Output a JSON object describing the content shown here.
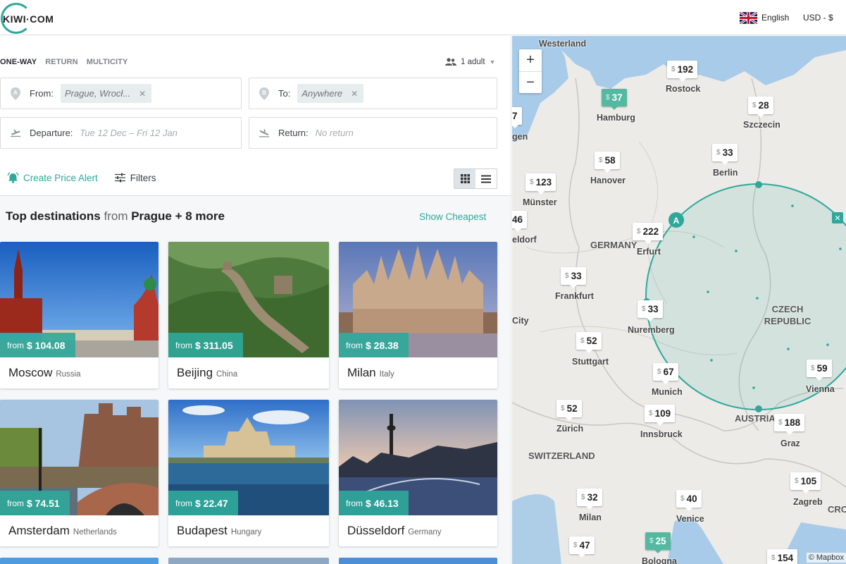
{
  "brand": {
    "name": "KIWI·COM",
    "accent": "#2fa89b"
  },
  "header": {
    "language": "English",
    "currency": "USD - $"
  },
  "search": {
    "trip_types": [
      "ONE-WAY",
      "RETURN",
      "MULTICITY"
    ],
    "active_trip_type": "ONE-WAY",
    "passengers": "1 adult",
    "from_label": "From:",
    "from_value": "Prague, Wrocł...",
    "to_label": "To:",
    "to_value": "Anywhere",
    "departure_label": "Departure:",
    "departure_value": "Tue 12 Dec – Fri 12 Jan",
    "return_label": "Return:",
    "return_value": "No return",
    "create_alert": "Create Price Alert",
    "filters": "Filters"
  },
  "results": {
    "heading_prefix": "Top destinations",
    "heading_from": "from",
    "heading_origin": "Prague + 8 more",
    "show_cheapest": "Show Cheapest",
    "price_prefix": "from",
    "cards": [
      {
        "city": "Moscow",
        "country": "Russia",
        "price": "$ 104.08"
      },
      {
        "city": "Beijing",
        "country": "China",
        "price": "$ 311.05"
      },
      {
        "city": "Milan",
        "country": "Italy",
        "price": "$ 28.38"
      },
      {
        "city": "Amsterdam",
        "country": "Netherlands",
        "price": "$ 74.51"
      },
      {
        "city": "Budapest",
        "country": "Hungary",
        "price": "$ 22.47"
      },
      {
        "city": "Düsseldorf",
        "country": "Germany",
        "price": "$ 46.13"
      }
    ]
  },
  "map": {
    "zoom_in": "+",
    "zoom_out": "−",
    "currency_symbol": "$",
    "attribution": "© Mapbox",
    "circle_label": "A",
    "countries": [
      "GERMANY",
      "CZECH REPUBLIC",
      "AUSTRIA",
      "SWITZERLAND",
      "CROATIA"
    ],
    "cities": [
      "Westerland",
      "Rostock",
      "Hamburg",
      "Szczecin",
      "Hanover",
      "Berlin",
      "Münster",
      "Erfurt",
      "Frankfurt",
      "Nuremberg",
      "Stuttgart",
      "Munich",
      "Vienna",
      "Zürich",
      "Innsbruck",
      "Graz",
      "Zagreb",
      "Milan",
      "Venice",
      "Bologna",
      "eldorf",
      "City",
      "gen"
    ],
    "prices": [
      "192",
      "37",
      "28",
      "58",
      "33",
      "123",
      "46",
      "222",
      "33",
      "33",
      "52",
      "67",
      "59",
      "52",
      "109",
      "188",
      "105",
      "32",
      "40",
      "47",
      "25",
      "154",
      "7"
    ]
  }
}
